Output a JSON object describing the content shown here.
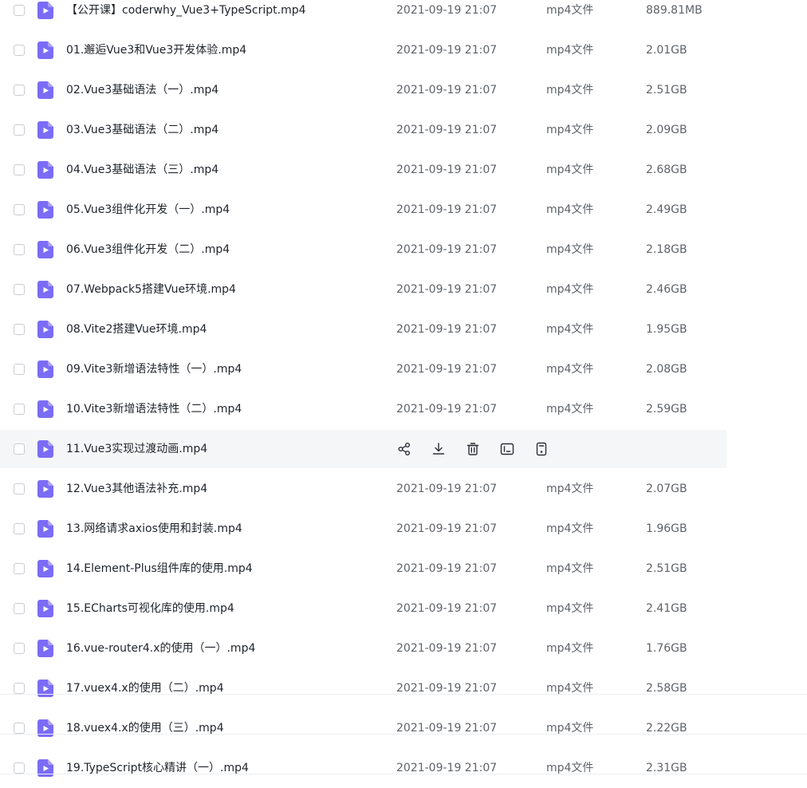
{
  "colors": {
    "icon_purple": "#7b6cf6",
    "hover_row": "#f5f6f8",
    "text_primary": "#1f2329",
    "text_secondary": "#5f6368"
  },
  "files": [
    {
      "name": "【公开课】coderwhy_Vue3+TypeScript.mp4",
      "date": "2021-09-19 21:07",
      "type": "mp4文件",
      "size": "889.81MB"
    },
    {
      "name": "01.邂逅Vue3和Vue3开发体验.mp4",
      "date": "2021-09-19 21:07",
      "type": "mp4文件",
      "size": "2.01GB"
    },
    {
      "name": "02.Vue3基础语法（一）.mp4",
      "date": "2021-09-19 21:07",
      "type": "mp4文件",
      "size": "2.51GB"
    },
    {
      "name": "03.Vue3基础语法（二）.mp4",
      "date": "2021-09-19 21:07",
      "type": "mp4文件",
      "size": "2.09GB"
    },
    {
      "name": "04.Vue3基础语法（三）.mp4",
      "date": "2021-09-19 21:07",
      "type": "mp4文件",
      "size": "2.68GB"
    },
    {
      "name": "05.Vue3组件化开发（一）.mp4",
      "date": "2021-09-19 21:07",
      "type": "mp4文件",
      "size": "2.49GB"
    },
    {
      "name": "06.Vue3组件化开发（二）.mp4",
      "date": "2021-09-19 21:07",
      "type": "mp4文件",
      "size": "2.18GB"
    },
    {
      "name": "07.Webpack5搭建Vue环境.mp4",
      "date": "2021-09-19 21:07",
      "type": "mp4文件",
      "size": "2.46GB"
    },
    {
      "name": "08.Vite2搭建Vue环境.mp4",
      "date": "2021-09-19 21:07",
      "type": "mp4文件",
      "size": "1.95GB"
    },
    {
      "name": "09.Vite3新增语法特性（一）.mp4",
      "date": "2021-09-19 21:07",
      "type": "mp4文件",
      "size": "2.08GB"
    },
    {
      "name": "10.Vite3新增语法特性（二）.mp4",
      "date": "2021-09-19 21:07",
      "type": "mp4文件",
      "size": "2.59GB"
    },
    {
      "name": "11.Vue3实现过渡动画.mp4",
      "hovered": true,
      "actions": [
        "share-icon",
        "download-icon",
        "delete-icon",
        "rename-icon",
        "more-icon"
      ]
    },
    {
      "name": "12.Vue3其他语法补充.mp4",
      "date": "2021-09-19 21:07",
      "type": "mp4文件",
      "size": "2.07GB"
    },
    {
      "name": "13.网络请求axios使用和封装.mp4",
      "date": "2021-09-19 21:07",
      "type": "mp4文件",
      "size": "1.96GB"
    },
    {
      "name": "14.Element-Plus组件库的使用.mp4",
      "date": "2021-09-19 21:07",
      "type": "mp4文件",
      "size": "2.51GB"
    },
    {
      "name": "15.ECharts可视化库的使用.mp4",
      "date": "2021-09-19 21:07",
      "type": "mp4文件",
      "size": "2.41GB"
    },
    {
      "name": "16.vue-router4.x的使用（一）.mp4",
      "date": "2021-09-19 21:07",
      "type": "mp4文件",
      "size": "1.76GB"
    },
    {
      "name": "17.vuex4.x的使用（二）.mp4",
      "date": "2021-09-19 21:07",
      "type": "mp4文件",
      "size": "2.58GB"
    },
    {
      "name": "18.vuex4.x的使用（三）.mp4",
      "date": "2021-09-19 21:07",
      "type": "mp4文件",
      "size": "2.22GB"
    },
    {
      "name": "19.TypeScript核心精讲（一）.mp4",
      "date": "2021-09-19 21:07",
      "type": "mp4文件",
      "size": "2.31GB"
    }
  ]
}
